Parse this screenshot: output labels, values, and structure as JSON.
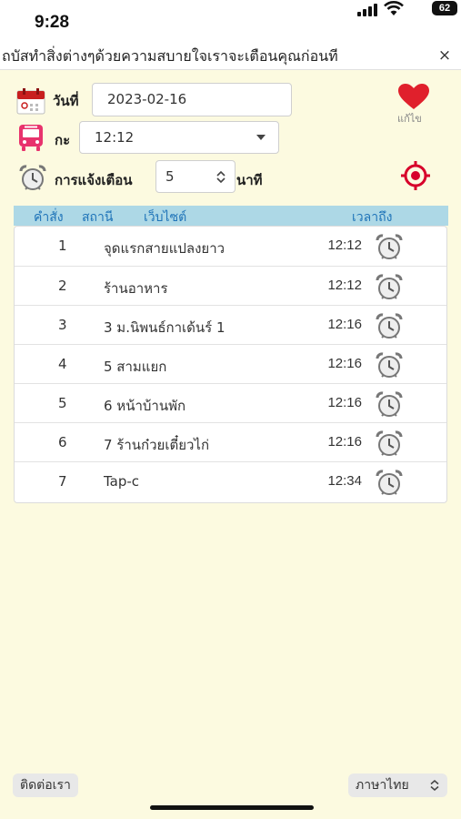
{
  "status": {
    "time": "9:28",
    "battery": "62"
  },
  "marquee": {
    "text": "ถบัสทำสิ่งต่างๆด้วยความสบายใจเราจะเตือนคุณก่อนที",
    "close": "×"
  },
  "form": {
    "date_label": "วันที่",
    "date_value": "2023-02-16",
    "edit_label": "แก้ไข",
    "shift_label": "กะ",
    "shift_value": "12:12",
    "alert_label": "การแจ้งเตือน",
    "alert_value": "5",
    "alert_unit": "นาที"
  },
  "table": {
    "headers": [
      "คำสั่ง",
      "สถานี",
      "เว็บไซต์",
      "เวลาถึง"
    ],
    "rows": [
      {
        "num": "1",
        "name": "จุดแรกสายแปลงยาว",
        "time": "12:12"
      },
      {
        "num": "2",
        "name": "ร้านอาหาร",
        "time": "12:12"
      },
      {
        "num": "3",
        "name": "3 ม.นิพนธ์กาเด้นร์ 1",
        "time": "12:16"
      },
      {
        "num": "4",
        "name": "5 สามแยก",
        "time": "12:16"
      },
      {
        "num": "5",
        "name": "6 หน้าบ้านพัก",
        "time": "12:16"
      },
      {
        "num": "6",
        "name": "7 ร้านก๋วยเตี๋ยวไก่",
        "time": "12:16"
      },
      {
        "num": "7",
        "name": "Tap-c",
        "time": "12:34"
      }
    ]
  },
  "footer": {
    "contact": "ติดต่อเรา",
    "language": "ภาษาไทย"
  },
  "colors": {
    "background": "#fcfae0",
    "table_header": "#add8e6",
    "heart": "#e0202c",
    "accent_red": "#d7002a"
  },
  "icons": [
    "calendar-icon",
    "bus-icon",
    "alarm-clock-icon",
    "heart-icon",
    "location-target-icon"
  ]
}
